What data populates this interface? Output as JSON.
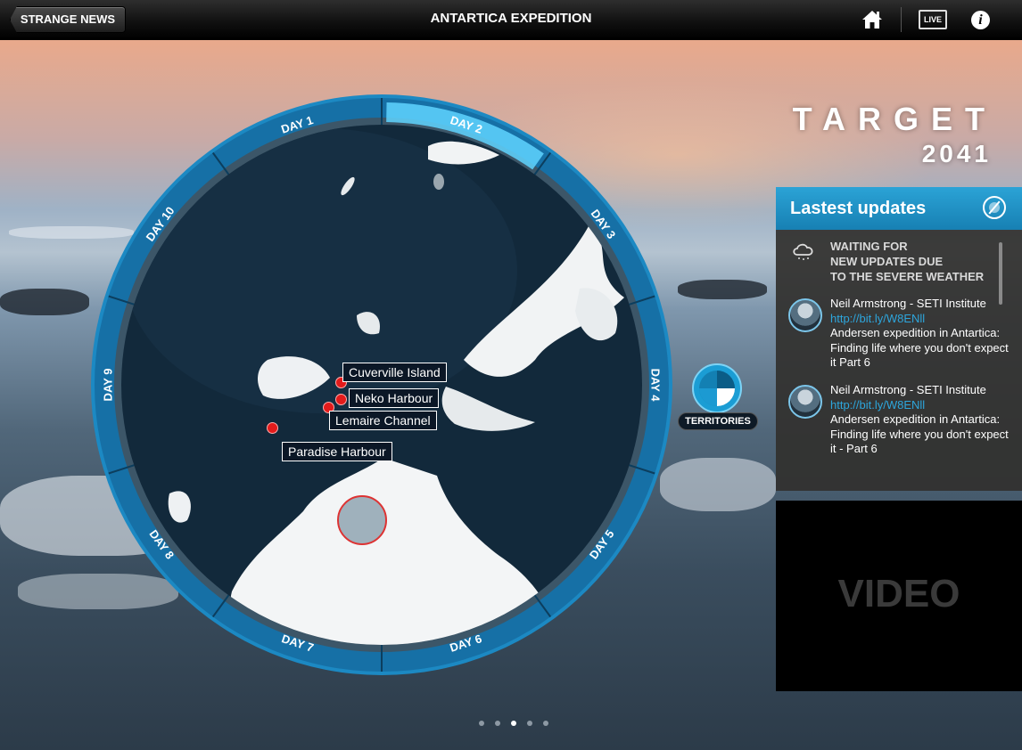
{
  "topbar": {
    "back_label": "STRANGE NEWS",
    "title": "ANTARTICA EXPEDITION",
    "live_label": "LIVE",
    "info_label": "i"
  },
  "brand": {
    "title": "TARGET",
    "year": "2041"
  },
  "map": {
    "days": [
      "DAY 1",
      "DAY 2",
      "DAY 3",
      "DAY 4",
      "DAY 5",
      "DAY 6",
      "DAY 7",
      "DAY 8",
      "DAY 9",
      "DAY 10"
    ],
    "active_day": "DAY 2",
    "locations": [
      "Cuverville Island",
      "Neko Harbour",
      "Lemaire Channel",
      "Paradise Harbour"
    ]
  },
  "territories": {
    "label": "TERRITORIES"
  },
  "updates": {
    "header": "Lastest updates",
    "notice": [
      "WAITING FOR",
      "NEW UPDATES DUE",
      "TO THE SEVERE WEATHER"
    ],
    "items": [
      {
        "author": "Neil Armstrong - SETI Institute",
        "link": "http://bit.ly/W8ENll",
        "text": "Andersen expedition in Antartica: Finding life where you don't expect it  Part 6"
      },
      {
        "author": "Neil Armstrong - SETI Institute",
        "link": "http://bit.ly/W8ENll",
        "text": "Andersen expedition in Antartica: Finding life where you don't expect it - Part 6"
      }
    ]
  },
  "video": {
    "label": "VIDEO"
  },
  "pager": {
    "count": 5,
    "current": 3
  },
  "colors": {
    "accent": "#1b9dd4",
    "ring": "#1670a6",
    "pin": "#e31b1b",
    "panel": "#32302e"
  }
}
